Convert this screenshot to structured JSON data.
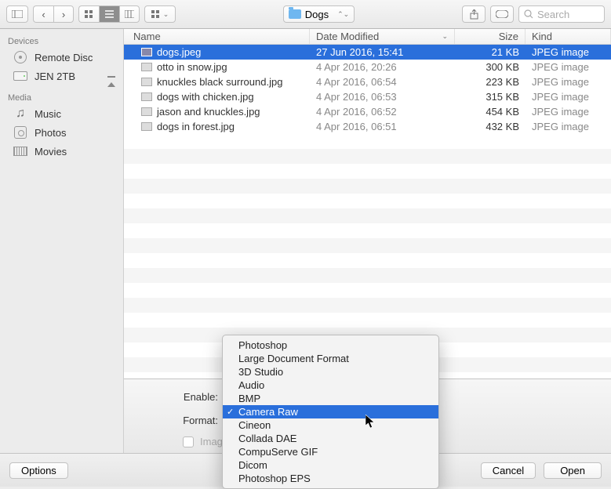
{
  "toolbar": {
    "path_name": "Dogs",
    "search_placeholder": "Search"
  },
  "sidebar": {
    "group1": "Devices",
    "group2": "Media",
    "remote_disc": "Remote Disc",
    "jen_2tb": "JEN 2TB",
    "music": "Music",
    "photos": "Photos",
    "movies": "Movies"
  },
  "columns": {
    "name": "Name",
    "date": "Date Modified",
    "size": "Size",
    "kind": "Kind"
  },
  "files": [
    {
      "name": "dogs.jpeg",
      "date": "27 Jun 2016, 15:41",
      "size": "21 KB",
      "kind": "JPEG image",
      "selected": true
    },
    {
      "name": "otto in snow.jpg",
      "date": "4 Apr 2016, 20:26",
      "size": "300 KB",
      "kind": "JPEG image",
      "selected": false
    },
    {
      "name": "knuckles black surround.jpg",
      "date": "4 Apr 2016, 06:54",
      "size": "223 KB",
      "kind": "JPEG image",
      "selected": false
    },
    {
      "name": "dogs with chicken.jpg",
      "date": "4 Apr 2016, 06:53",
      "size": "315 KB",
      "kind": "JPEG image",
      "selected": false
    },
    {
      "name": "jason and knuckles.jpg",
      "date": "4 Apr 2016, 06:52",
      "size": "454 KB",
      "kind": "JPEG image",
      "selected": false
    },
    {
      "name": "dogs in forest.jpg",
      "date": "4 Apr 2016, 06:51",
      "size": "432 KB",
      "kind": "JPEG image",
      "selected": false
    }
  ],
  "controls": {
    "enable_label": "Enable:",
    "format_label": "Format:",
    "image_sequence": "Image Sequence",
    "options": "Options",
    "cancel": "Cancel",
    "open": "Open"
  },
  "format_menu": {
    "items": [
      "Photoshop",
      "Large Document Format",
      "3D Studio",
      "Audio",
      "BMP",
      "Camera Raw",
      "Cineon",
      "Collada DAE",
      "CompuServe GIF",
      "Dicom",
      "Photoshop EPS"
    ],
    "selected_index": 5
  }
}
